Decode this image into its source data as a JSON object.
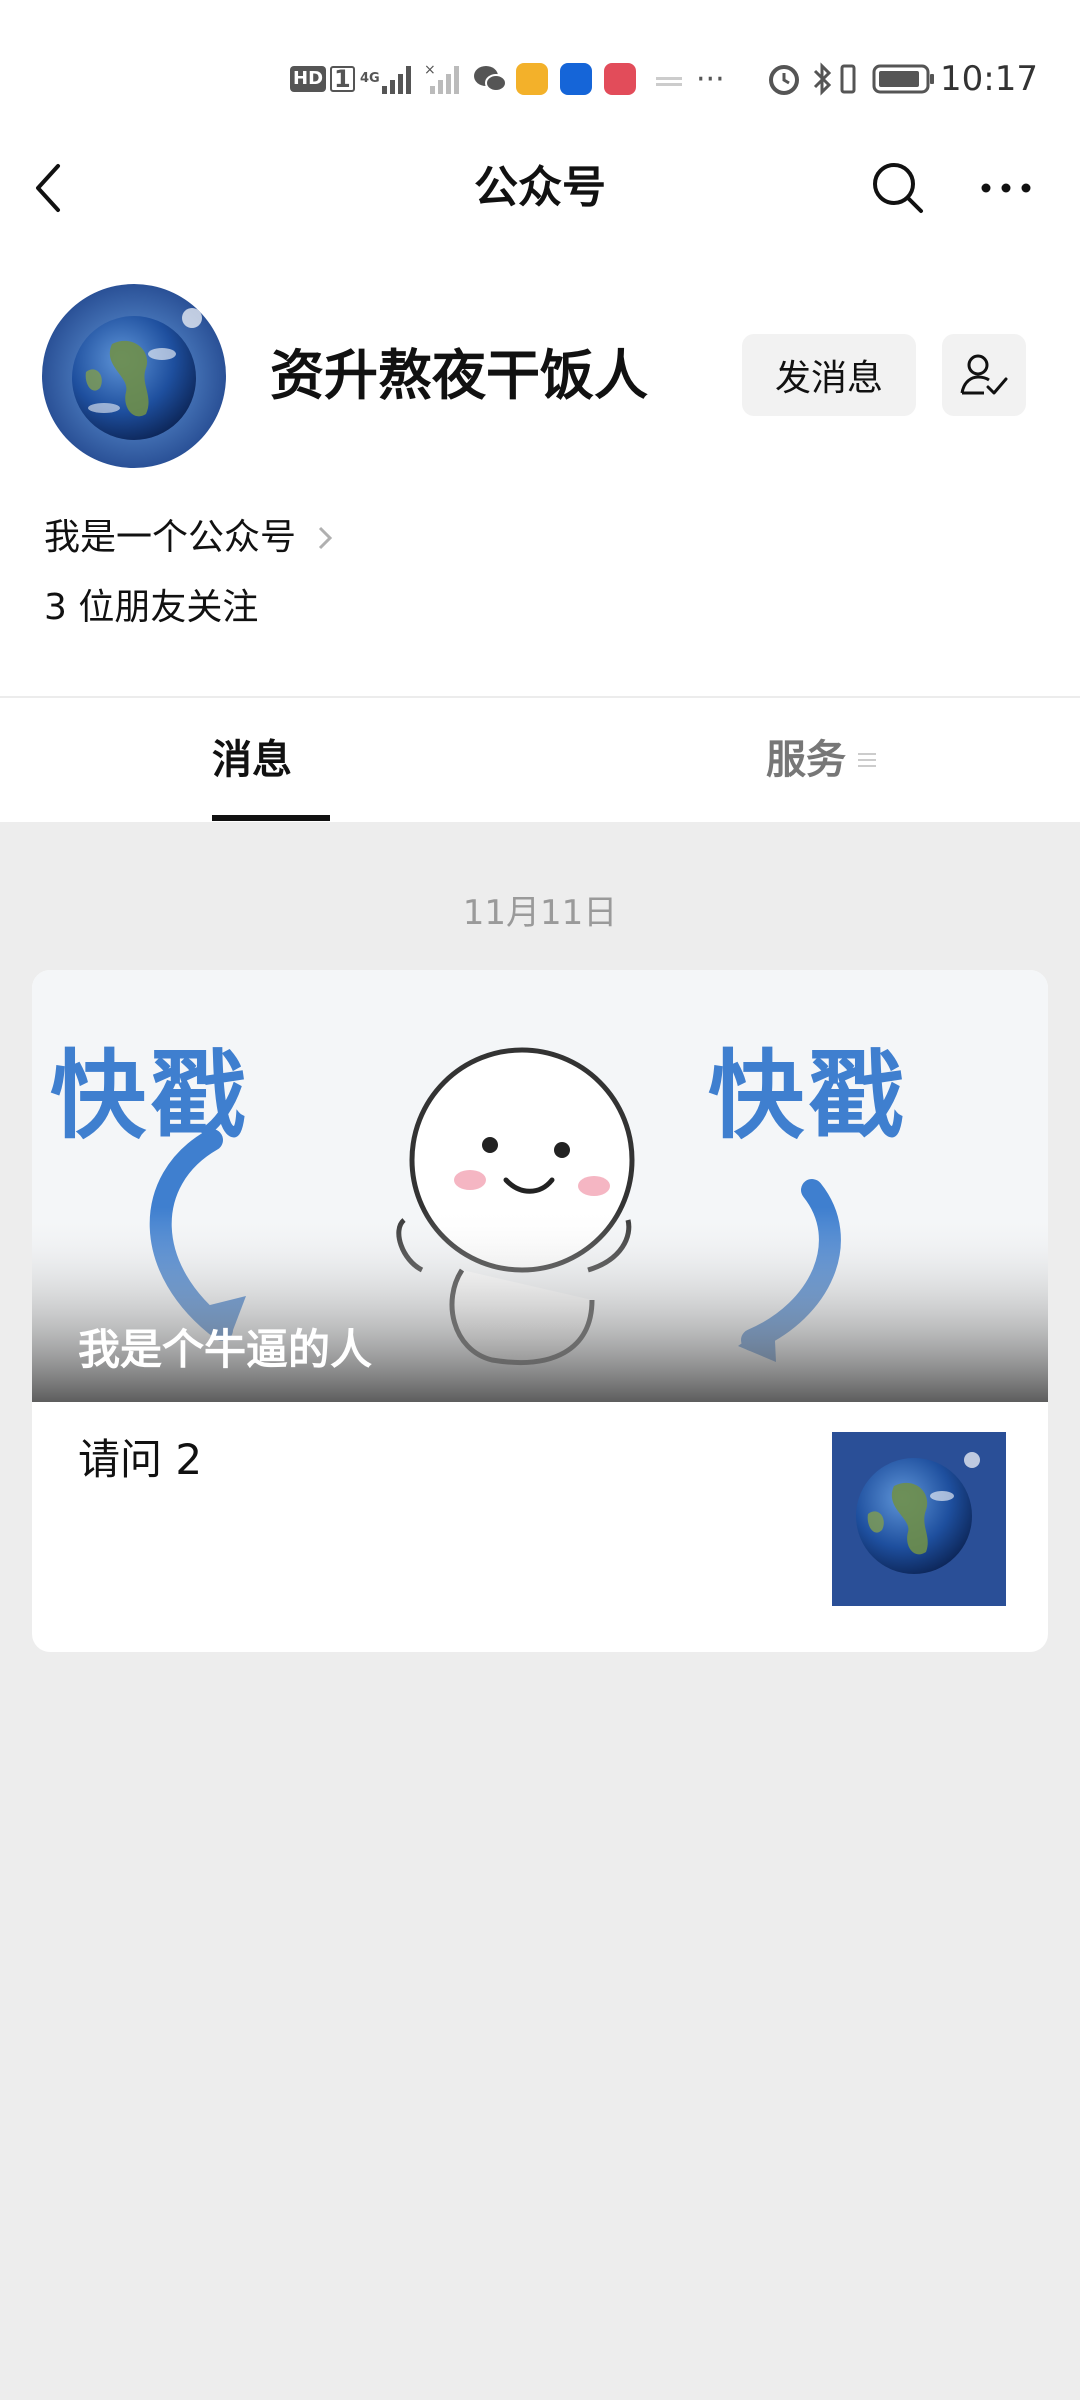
{
  "status_bar": {
    "hd": "HD",
    "sim": "1",
    "network": "4G",
    "more": "···",
    "time": "10:17"
  },
  "nav": {
    "title": "公众号",
    "icons": [
      "back-arrow-icon",
      "search-icon",
      "more-icon"
    ]
  },
  "profile": {
    "name": "资升熬夜干饭人",
    "message_button": "发消息",
    "description": "我是一个公众号",
    "followers": "3 位朋友关注"
  },
  "tabs": [
    {
      "label": "消息",
      "active": true
    },
    {
      "label": "服务",
      "active": false
    }
  ],
  "feed": {
    "date": "11月11日",
    "card": {
      "cover_title": "我是个牛逼的人",
      "cover_text": "快戳",
      "sub_title": "请问 2"
    }
  },
  "colors": {
    "page_bg": "#ededed",
    "panel_bg": "#ffffff",
    "arrow_blue": "#3f7fcf",
    "earth_blue": "#1e4f9e"
  }
}
